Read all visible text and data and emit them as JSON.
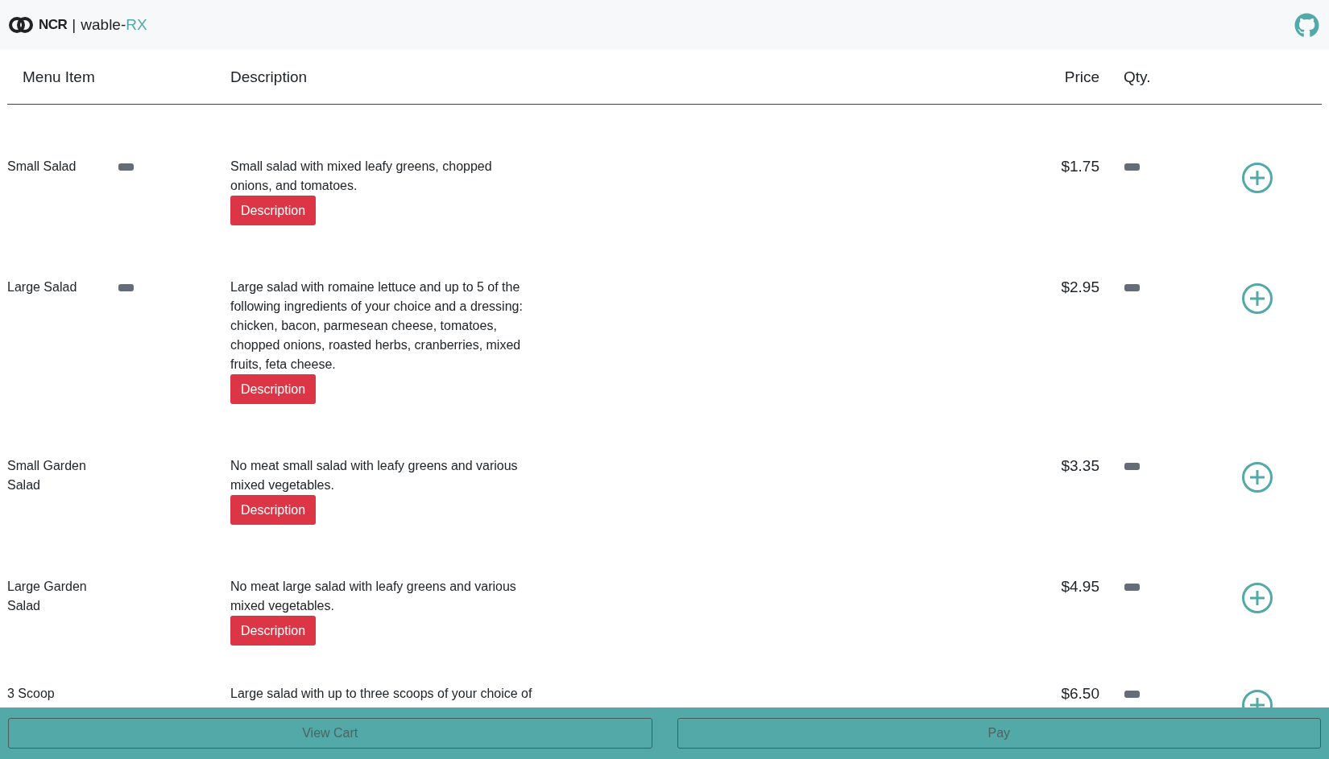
{
  "brand": {
    "logo_text": "NCR",
    "separator": "|",
    "name": "wable-",
    "name_accent": "RX"
  },
  "table": {
    "columns": [
      "Menu Item",
      "Description",
      "Price",
      "Qty."
    ],
    "rows": [
      {
        "name": "Small Salad",
        "badge": true,
        "description": "Small salad with mixed leafy greens, chopped onions, and tomatoes.",
        "button": "Description",
        "price": "$1.75"
      },
      {
        "name": "Large Salad",
        "badge": true,
        "description": "Large salad with romaine lettuce and up to 5 of the following ingredients of your choice and a dressing: chicken, bacon, parmesean cheese, tomatoes, chopped onions, roasted herbs, cranberries, mixed fruits, feta cheese.",
        "button": "Description",
        "price": "$2.95"
      },
      {
        "name": "Small Garden Salad",
        "badge": false,
        "description": "No meat small salad with leafy greens and various mixed vegetables.",
        "button": "Description",
        "price": "$3.35"
      },
      {
        "name": "Large Garden Salad",
        "badge": false,
        "description": "No meat large salad with leafy greens and various mixed vegetables.",
        "button": "Description",
        "price": "$4.95"
      },
      {
        "name": "3 Scoop",
        "badge": false,
        "description": "Large salad with up to three scoops of your choice of",
        "price": "$6.50"
      }
    ]
  },
  "footer": {
    "buttons": [
      "View Cart",
      "Pay"
    ]
  }
}
